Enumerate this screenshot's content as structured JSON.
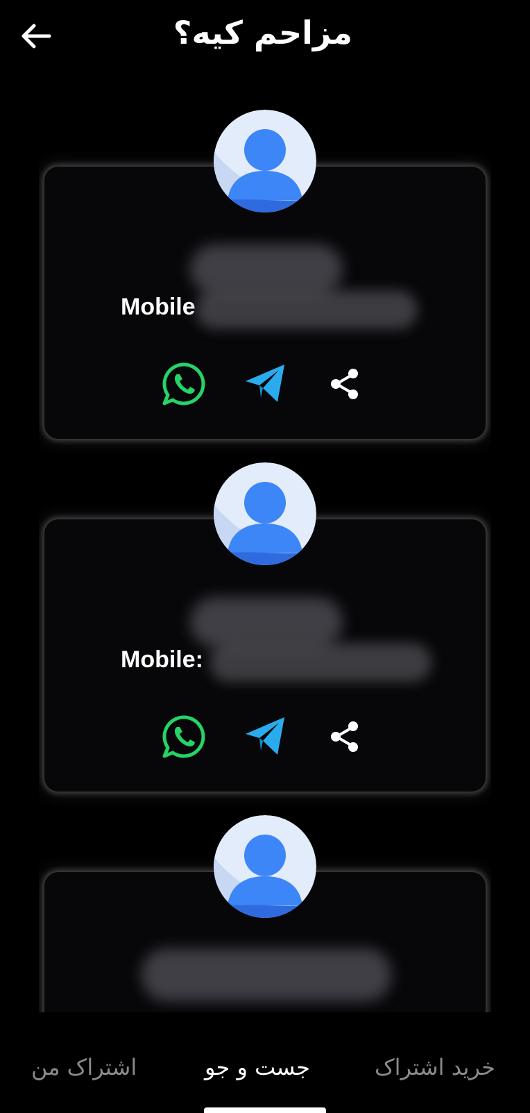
{
  "header": {
    "title": "مزاحم کیه؟",
    "back_icon": "arrow-left-icon"
  },
  "results": [
    {
      "mobile_label": "Mobile",
      "actions": [
        "whatsapp-icon",
        "telegram-icon",
        "share-icon"
      ]
    },
    {
      "mobile_label": "Mobile:",
      "actions": [
        "whatsapp-icon",
        "telegram-icon",
        "share-icon"
      ]
    },
    {
      "mobile_label": "",
      "actions": []
    }
  ],
  "bottom_nav": {
    "items": [
      {
        "label": "اشتراک من",
        "active": false
      },
      {
        "label": "جست و جو",
        "active": true
      },
      {
        "label": "خرید اشتراک",
        "active": false
      }
    ]
  },
  "colors": {
    "whatsapp": "#25D366",
    "telegram": "#2AABEE",
    "avatar_bg": "#E3ECFB",
    "avatar_figure": "#3D86F7"
  }
}
